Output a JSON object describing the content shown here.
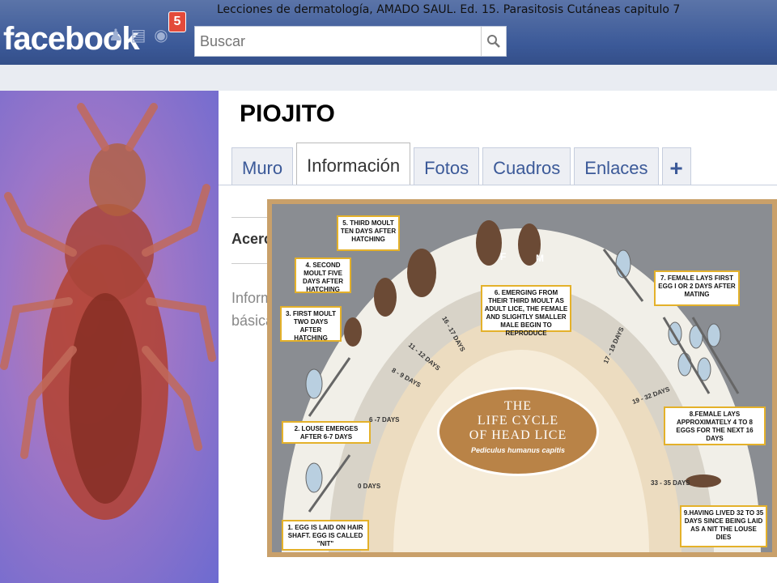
{
  "caption": "Lecciones de dermatología, AMADO SAUL. Ed. 15. Parasitosis Cutáneas capitulo 7",
  "header": {
    "logo": "facebook",
    "notification_count": "5",
    "search_placeholder": "Buscar",
    "icons": [
      "friends-icon",
      "messages-icon",
      "globe-icon",
      "search-icon"
    ]
  },
  "profile": {
    "name": "PIOJITO",
    "tabs": [
      {
        "label": "Muro",
        "active": false
      },
      {
        "label": "Información",
        "active": true
      },
      {
        "label": "Fotos",
        "active": false
      },
      {
        "label": "Cuadros",
        "active": false
      },
      {
        "label": "Enlaces",
        "active": false
      },
      {
        "label": "+",
        "active": false
      }
    ],
    "section_title": "Acerca",
    "info_text": "Información básica"
  },
  "poster": {
    "title_line1": "THE",
    "title_line2": "LIFE CYCLE",
    "title_line3": "OF HEAD LICE",
    "subtitle": "Pediculus humanus capitis",
    "stages": [
      "1. EGG IS LAID ON HAIR SHAFT. EGG IS CALLED \"NIT\"",
      "2. LOUSE EMERGES AFTER 6-7 DAYS",
      "3. FIRST MOULT TWO DAYS AFTER HATCHING",
      "4. SECOND MOULT FIVE DAYS AFTER HATCHING",
      "5. THIRD MOULT TEN DAYS AFTER HATCHING",
      "6. EMERGING FROM THEIR THIRD MOULT AS ADULT LICE, THE FEMALE AND SLIGHTLY SMALLER MALE BEGIN TO REPRODUCE",
      "7. FEMALE LAYS FIRST EGG I OR 2 DAYS AFTER MATING",
      "8.FEMALE LAYS APPROXIMATELY 4 TO 8 EGGS FOR THE NEXT 16 DAYS",
      "9.HAVING LIVED 32 TO 35 DAYS SINCE BEING LAID AS A NIT THE LOUSE DIES"
    ],
    "days": [
      "0 DAYS",
      "6 -7 DAYS",
      "8 - 9 DAYS",
      "11 - 12 DAYS",
      "16 - 17 DAYS",
      "17 - 19 DAYS",
      "19 - 32 DAYS",
      "33 - 35 DAYS"
    ],
    "sex_labels": [
      "F",
      "M"
    ]
  }
}
